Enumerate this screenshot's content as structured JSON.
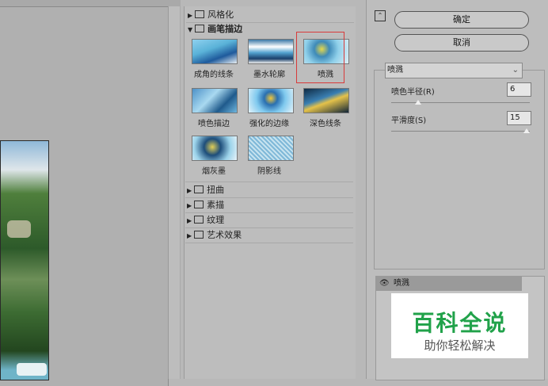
{
  "gallery": {
    "categories_top": [
      {
        "label": "风格化",
        "expanded": false
      },
      {
        "label": "画笔描边",
        "expanded": true
      }
    ],
    "filters": [
      {
        "label": "成角的线条"
      },
      {
        "label": "墨水轮廓"
      },
      {
        "label": "喷溅",
        "selected": true
      },
      {
        "label": "喷色描边"
      },
      {
        "label": "强化的边缘"
      },
      {
        "label": "深色线条"
      },
      {
        "label": "烟灰墨"
      },
      {
        "label": "阴影线"
      }
    ],
    "categories_bottom": [
      {
        "label": "扭曲"
      },
      {
        "label": "素描"
      },
      {
        "label": "纹理"
      },
      {
        "label": "艺术效果"
      }
    ]
  },
  "buttons": {
    "ok": "确定",
    "cancel": "取消"
  },
  "settings": {
    "filter_select": "喷溅",
    "params": [
      {
        "label": "喷色半径(R)",
        "value": "6",
        "level": 0.2
      },
      {
        "label": "平滑度(S)",
        "value": "15",
        "level": 1.0
      }
    ]
  },
  "layers": {
    "active": "喷溅"
  },
  "watermark": {
    "title": "百科全说",
    "subtitle": "助你轻松解决"
  }
}
